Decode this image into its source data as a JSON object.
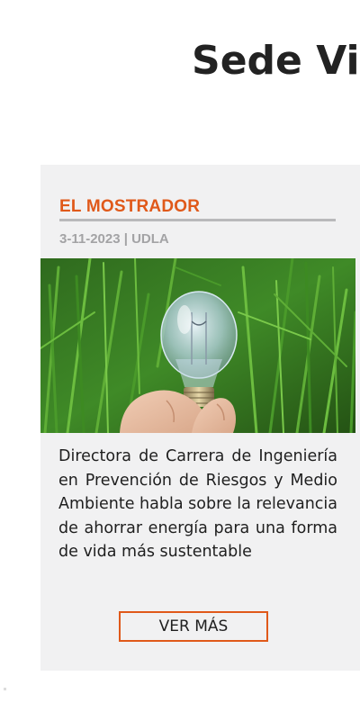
{
  "page": {
    "heading": "Sede Vir"
  },
  "card": {
    "category": "EL MOSTRADOR",
    "meta": "3-11-2023 | UDLA",
    "image_alt": "lightbulb-in-hand-on-grass",
    "description": "Directora de Carrera de Ingeniería en Prevención de Riesgos y Medio Ambiente habla sobre la relevancia de ahorrar energía para una forma de vida más sustentable",
    "button_label": "VER MÁS"
  },
  "colors": {
    "accent": "#e0591a",
    "card_background": "#f1f1f2",
    "meta_gray": "#a3a3a5",
    "rule_gray": "#b9b9bb",
    "text": "#1f1f1f"
  }
}
